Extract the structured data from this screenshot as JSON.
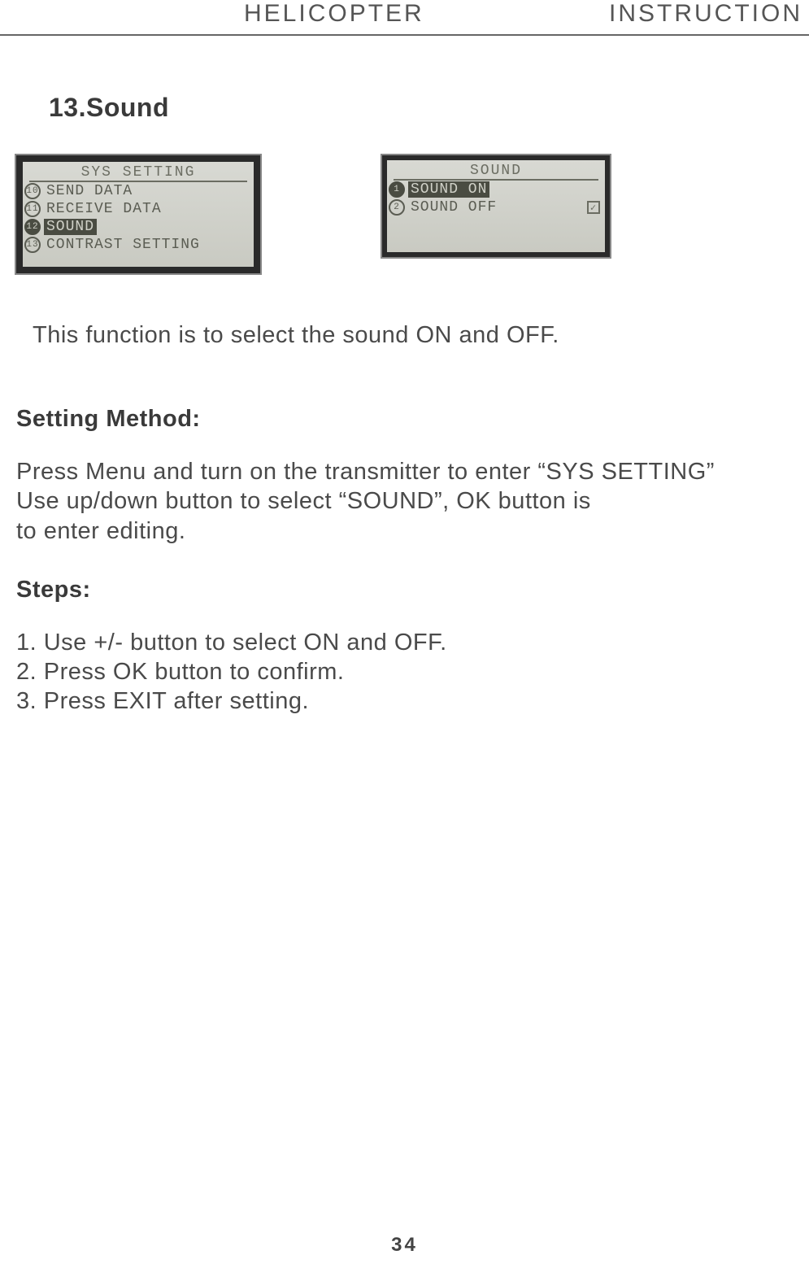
{
  "header": {
    "left": "HELICOPTER",
    "right": "INSTRUCTION"
  },
  "section_title": "13.Sound",
  "lcd1": {
    "title": "SYS SETTING",
    "rows": [
      {
        "num": "10",
        "text": "SEND DATA",
        "selected": false
      },
      {
        "num": "11",
        "text": "RECEIVE DATA",
        "selected": false
      },
      {
        "num": "12",
        "text": "SOUND",
        "selected": true
      },
      {
        "num": "13",
        "text": "CONTRAST SETTING",
        "selected": false
      }
    ]
  },
  "lcd2": {
    "title": "SOUND",
    "rows": [
      {
        "num": "1",
        "text": "SOUND ON",
        "selected": true,
        "check": false
      },
      {
        "num": "2",
        "text": "SOUND OFF",
        "selected": false,
        "check": true
      }
    ]
  },
  "description": "This function is to select the sound ON and OFF.",
  "setting_method_heading": "Setting Method:",
  "setting_method_body_line1": "Press Menu and turn on the transmitter to enter “SYS SETTING”",
  "setting_method_body_line2": "Use up/down button to select “SOUND”, OK button is",
  "setting_method_body_line3": "to enter editing.",
  "steps_heading": "Steps:",
  "steps": [
    "1. Use +/- button to select ON and OFF.",
    "2. Press OK button to confirm.",
    "3. Press EXIT after setting."
  ],
  "page_number": "34"
}
